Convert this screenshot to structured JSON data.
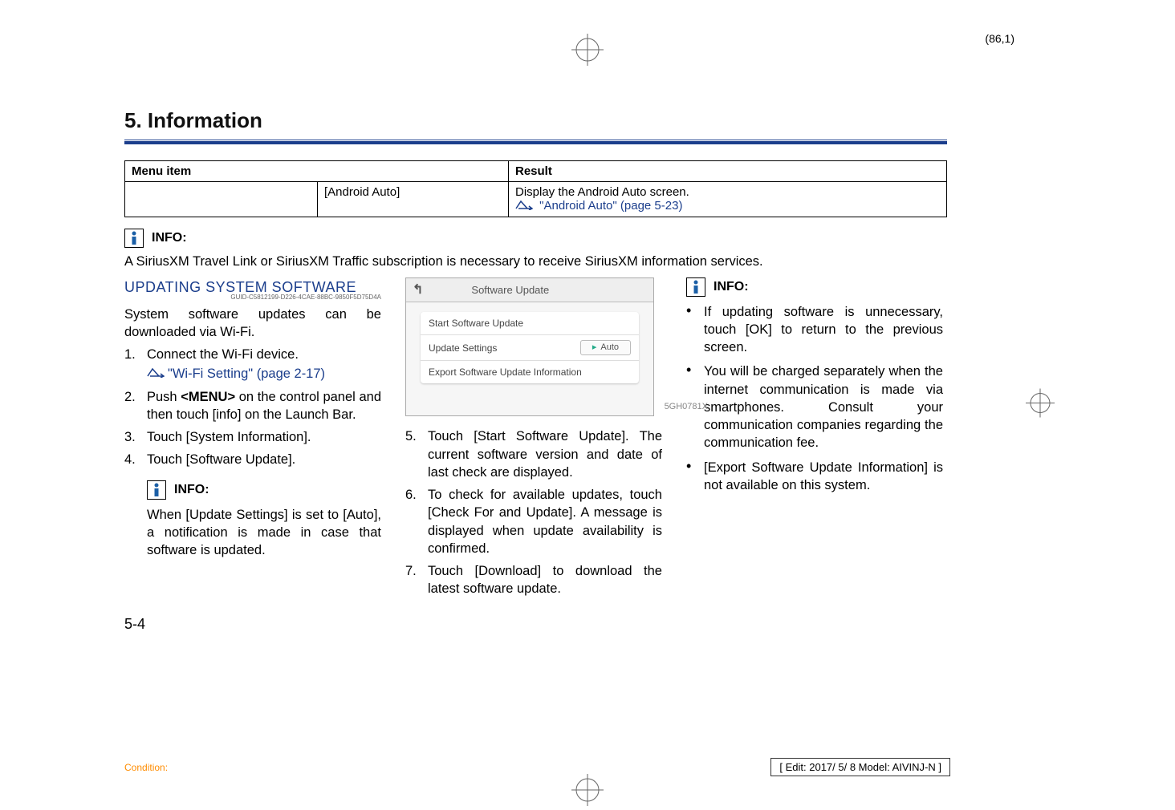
{
  "page_indicator": "(86,1)",
  "section_title": "5. Information",
  "table": {
    "header_menu": "Menu item",
    "header_result": "Result",
    "cell_android": "[Android Auto]",
    "cell_result_line1": "Display the Android Auto screen.",
    "cell_result_link": "\"Android Auto\" (page 5-23)"
  },
  "info_label": "INFO:",
  "subscription_note": "A SiriusXM Travel Link or SiriusXM Traffic subscription is necessary to receive SiriusXM information services.",
  "col1": {
    "heading": "UPDATING SYSTEM SOFTWARE",
    "guid": "GUID-C5812199-D226-4CAE-88BC-9850F5D75D4A",
    "intro": "System software updates can be downloaded via Wi-Fi.",
    "step1": "Connect the Wi-Fi device.",
    "step1_link": "\"Wi-Fi Setting\" (page 2-17)",
    "step2_pre": "Push ",
    "step2_bold": "<MENU>",
    "step2_post": " on the control panel and then touch [info] on the Launch Bar.",
    "step3": "Touch [System Information].",
    "step4": "Touch [Software Update].",
    "info_note": "When [Update Settings] is set to [Auto], a notification is made in case that software is updated."
  },
  "screenshot": {
    "title": "Software Update",
    "row1": "Start Software Update",
    "row2_label": "Update Settings",
    "row2_value": "Auto",
    "row3": "Export Software Update Information",
    "code": "5GH0781X"
  },
  "col2": {
    "step5": "Touch [Start Software Update]. The current software version and date of last check are displayed.",
    "step6": "To check for available updates, touch [Check For and Update]. A message is displayed when update availability is confirmed.",
    "step7": "Touch [Download] to download the latest software update."
  },
  "col3": {
    "b1": "If updating software is unnecessary, touch [OK] to return to the previous screen.",
    "b2": "You will be charged separately when the internet communication is made via smartphones. Consult your communication companies regarding the communication fee.",
    "b3": "[Export Software Update Information] is not available on this system."
  },
  "page_num": "5-4",
  "condition": "Condition:",
  "edit_box": "[ Edit: 2017/ 5/ 8   Model:  AIVINJ-N ]"
}
